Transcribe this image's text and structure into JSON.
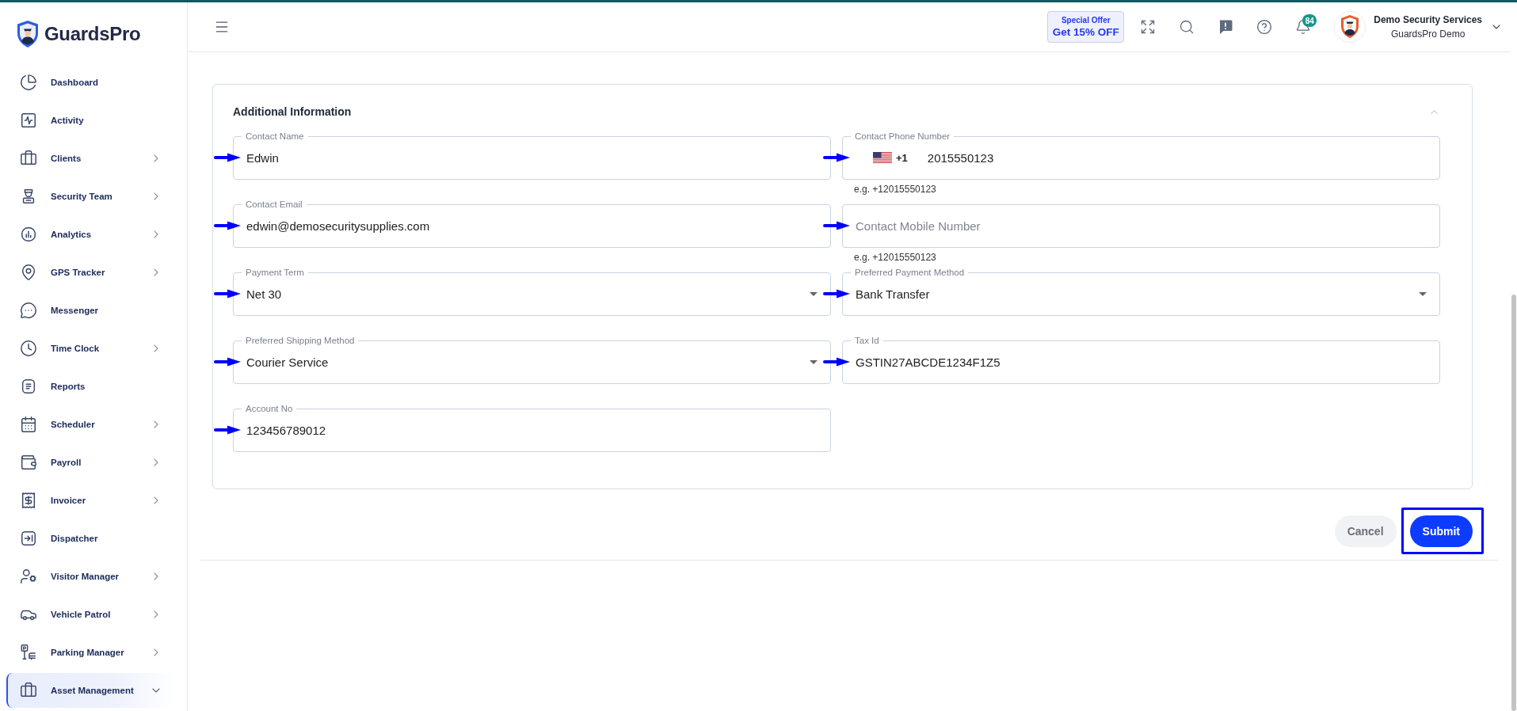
{
  "sidebar": {
    "logo": {
      "text": "GuardsPro"
    },
    "items": [
      {
        "label": "Dashboard",
        "submenu": false,
        "selected": false
      },
      {
        "label": "Activity",
        "submenu": false,
        "selected": false
      },
      {
        "label": "Clients",
        "submenu": true,
        "expanded": false,
        "selected": false
      },
      {
        "label": "Security Team",
        "submenu": true,
        "expanded": false,
        "selected": false
      },
      {
        "label": "Analytics",
        "submenu": true,
        "expanded": false,
        "selected": false
      },
      {
        "label": "GPS Tracker",
        "submenu": true,
        "expanded": false,
        "selected": false
      },
      {
        "label": "Messenger",
        "submenu": false,
        "selected": false
      },
      {
        "label": "Time Clock",
        "submenu": true,
        "expanded": false,
        "selected": false
      },
      {
        "label": "Reports",
        "submenu": false,
        "selected": false
      },
      {
        "label": "Scheduler",
        "submenu": true,
        "expanded": false,
        "selected": false
      },
      {
        "label": "Payroll",
        "submenu": true,
        "expanded": false,
        "selected": false
      },
      {
        "label": "Invoicer",
        "submenu": true,
        "expanded": false,
        "selected": false
      },
      {
        "label": "Dispatcher",
        "submenu": false,
        "selected": false
      },
      {
        "label": "Visitor Manager",
        "submenu": true,
        "expanded": false,
        "selected": false
      },
      {
        "label": "Vehicle Patrol",
        "submenu": true,
        "expanded": false,
        "selected": false
      },
      {
        "label": "Parking Manager",
        "submenu": true,
        "expanded": false,
        "selected": false
      },
      {
        "label": "Asset Management",
        "submenu": true,
        "expanded": true,
        "selected": true
      }
    ]
  },
  "topbar": {
    "offer": {
      "title": "Special Offer",
      "text": "Get 15% OFF"
    },
    "notifications": {
      "count": "84"
    },
    "account": {
      "name": "Demo Security Services",
      "subtitle": "GuardsPro Demo"
    }
  },
  "form": {
    "title": "Additional Information",
    "expanded": true,
    "fields": [
      {
        "kind": "text",
        "label": "Contact Name",
        "value": "Edwin",
        "annotated": true
      },
      {
        "kind": "phone",
        "label": "Contact Phone Number",
        "country_code": "+1",
        "value": "2015550123",
        "helper": "e.g. +12015550123",
        "annotated": true
      },
      {
        "kind": "text",
        "label": "Contact Email",
        "value": "edwin@demosecuritysupplies.com",
        "annotated": true
      },
      {
        "kind": "text",
        "placeholder": "Contact Mobile Number",
        "helper": "e.g. +12015550123",
        "annotated": true
      },
      {
        "kind": "select",
        "label": "Payment Term",
        "value": "Net 30",
        "annotated": true
      },
      {
        "kind": "select",
        "label": "Preferred Payment Method",
        "value": "Bank Transfer",
        "annotated": true
      },
      {
        "kind": "select",
        "label": "Preferred Shipping Method",
        "value": "Courier Service",
        "annotated": true
      },
      {
        "kind": "text",
        "label": "Tax Id",
        "value": "GSTIN27ABCDE1234F1Z5",
        "annotated": true
      },
      {
        "kind": "text",
        "label": "Account No",
        "value": "123456789012",
        "annotated": true
      }
    ],
    "buttons": [
      {
        "kind": "secondary",
        "label": "Cancel",
        "highlighted": false
      },
      {
        "kind": "primary",
        "label": "Submit",
        "highlighted": true
      }
    ]
  }
}
